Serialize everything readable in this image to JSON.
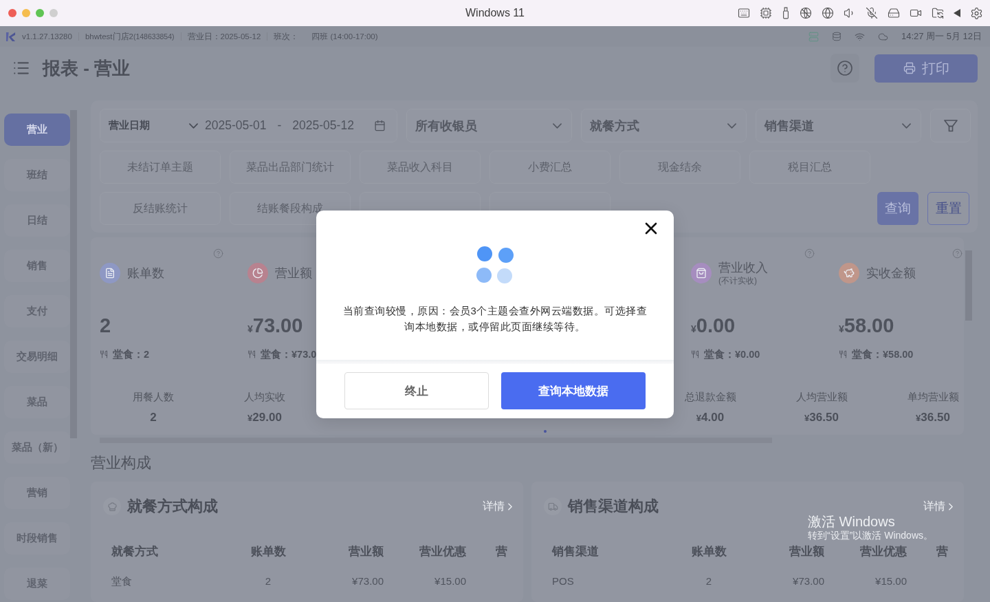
{
  "window": {
    "title": "Windows 11"
  },
  "status_bar": {
    "version": "v1.1.27.13280",
    "store": "bhwtest门店2",
    "store_id": "(148633854)",
    "business_day": "营业日：2025-05-12",
    "shift_label": "班次：",
    "shift": "四班 (14:00-17:00)",
    "clock": "14:27 周一 5月 12日"
  },
  "header": {
    "title": "报表 - 营业",
    "print_button": "打印"
  },
  "sidebar": {
    "items": [
      {
        "label": "营业",
        "selected": true
      },
      {
        "label": "班结",
        "selected": false
      },
      {
        "label": "日结",
        "selected": false
      },
      {
        "label": "销售",
        "selected": false
      },
      {
        "label": "支付",
        "selected": false
      },
      {
        "label": "交易明细",
        "selected": false
      },
      {
        "label": "菜品",
        "selected": false
      },
      {
        "label": "菜品（新）",
        "selected": false
      },
      {
        "label": "营销",
        "selected": false
      },
      {
        "label": "时段销售",
        "selected": false
      },
      {
        "label": "退菜",
        "selected": false
      }
    ]
  },
  "filters": {
    "date_type": "营业日期",
    "start_date": "2025-05-01",
    "date_separator": "-",
    "end_date": "2025-05-12",
    "selects": [
      "所有收银员",
      "就餐方式",
      "销售渠道"
    ],
    "reports": [
      "未结订单主题",
      "菜品出品部门统计",
      "菜品收入科目",
      "小费汇总",
      "现金结余",
      "税目汇总",
      "反结账统计",
      "结账餐段构成"
    ],
    "query_button": "查询",
    "reset_button": "重置"
  },
  "summary": {
    "cards_left": [
      {
        "kind": "bills",
        "color": "#8e98c4",
        "title": "账单数",
        "value": "2",
        "detail": "堂食：2"
      },
      {
        "kind": "revenue",
        "color": "#b8828f",
        "title": "营业额",
        "currency": "¥",
        "value": "73.00",
        "detail": "堂食：¥73.0"
      }
    ],
    "cards_right": [
      {
        "kind": "income",
        "color": "#a68dbf",
        "title": "营业收入",
        "subtitle": "(不计实收)",
        "currency": "¥",
        "value": "0.00",
        "detail": "堂食：¥0.00"
      },
      {
        "kind": "received",
        "color": "#c0968a",
        "title": "实收金额",
        "currency": "¥",
        "value": "58.00",
        "detail": "堂食：¥58.00"
      }
    ],
    "metrics_left": [
      {
        "label": "用餐人数",
        "value": "2"
      },
      {
        "label": "人均实收",
        "currency": "¥",
        "value": "29.00"
      }
    ],
    "metrics_right": [
      {
        "label": "总退款金额",
        "currency": "¥",
        "value": "4.00"
      },
      {
        "label": "人均营业额",
        "currency": "¥",
        "value": "36.50"
      },
      {
        "label": "单均营业额",
        "currency": "¥",
        "value": "36.50"
      }
    ]
  },
  "composition": {
    "title": "营业构成",
    "panels": [
      {
        "kind": "dining",
        "title": "就餐方式构成",
        "link": "详情",
        "columns": [
          "就餐方式",
          "账单数",
          "营业额",
          "营业优惠",
          "营"
        ],
        "rows": [
          [
            "堂食",
            "2",
            "¥73.00",
            "¥15.00"
          ]
        ]
      },
      {
        "kind": "channel",
        "title": "销售渠道构成",
        "link": "详情",
        "columns": [
          "销售渠道",
          "账单数",
          "营业额",
          "营业优惠",
          "营"
        ],
        "rows": [
          [
            "POS",
            "2",
            "¥73.00",
            "¥15.00"
          ]
        ]
      }
    ]
  },
  "dialog": {
    "message": "当前查询较慢，原因：会员3个主题会查外网云端数据。可选择查询本地数据，或停留此页面继续等待。",
    "buttons": [
      {
        "kind": "secondary",
        "label": "终止"
      },
      {
        "kind": "primary",
        "label": "查询本地数据"
      }
    ]
  },
  "os_notice": {
    "title": "激活 Windows",
    "hint": "转到“设置”以激活 Windows。"
  }
}
